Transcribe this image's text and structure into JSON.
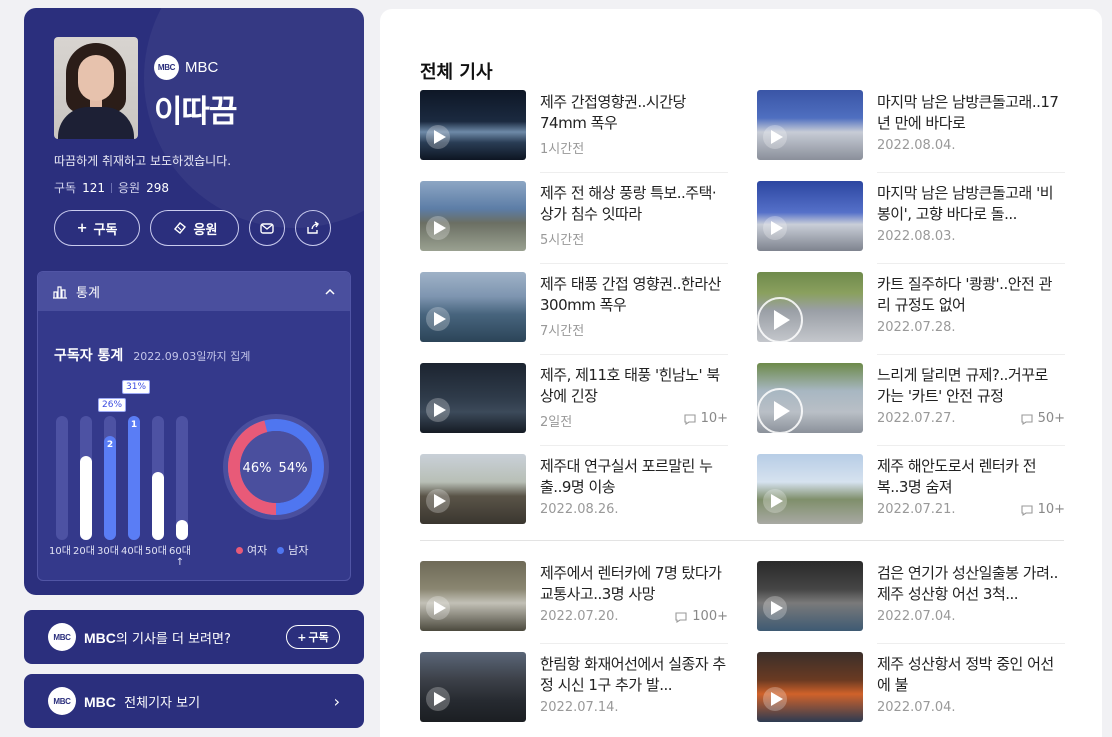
{
  "profile": {
    "brand": "MBC",
    "logo_text": "MBC",
    "name": "이따끔",
    "intro": "따끔하게 취재하고 보도하겠습니다.",
    "subscribe_label": "구독",
    "subscribe_count": "121",
    "cheer_label": "응원",
    "cheer_count": "298",
    "subscribe_button": "구독",
    "cheer_button": "응원"
  },
  "stats": {
    "header": "통계",
    "title": "구독자 통계",
    "date_note": "2022.09.03일까지 집계",
    "tag_30s": "26%",
    "tag_40s": "31%",
    "rank_30s": "2",
    "rank_40s": "1",
    "female_pct": "46%",
    "male_pct": "54%",
    "legend_female": "여자",
    "legend_male": "남자",
    "colors": {
      "female": "#e85a78",
      "male": "#4f76f0"
    }
  },
  "chart_data": {
    "type": "bar",
    "categories": [
      "10대",
      "20대",
      "30대",
      "40대",
      "50대",
      "60대↑"
    ],
    "values": [
      0,
      21,
      26,
      31,
      17,
      5
    ],
    "highlight": [
      false,
      false,
      true,
      true,
      false,
      false
    ],
    "pie": {
      "type": "pie",
      "labels": [
        "여자",
        "남자"
      ],
      "values": [
        46,
        54
      ]
    }
  },
  "promo": {
    "more_brand": "MBC",
    "more_text": "의 기사를 더 보려면?",
    "more_button": "구독",
    "all_brand": "MBC",
    "all_text": "전체기자 보기"
  },
  "main": {
    "title": "전체 기사",
    "articles": [
      {
        "title": "제주 간접영향권..시간당 74mm 폭우",
        "date": "1시간전",
        "comments": "",
        "thumb": "waves"
      },
      {
        "title": "마지막 남은 남방큰돌고래..17년 만에 바다로",
        "date": "2022.08.04.",
        "comments": "",
        "thumb": "dolphin"
      },
      {
        "title": "제주 전 해상 풍랑 특보..주택·상가 침수 잇따라",
        "date": "5시간전",
        "comments": "",
        "thumb": "coast"
      },
      {
        "title": "마지막 남은 남방큰돌고래 '비봉이', 고향 바다로 돌...",
        "date": "2022.08.03.",
        "comments": "",
        "thumb": "dolphin2"
      },
      {
        "title": "제주 태풍 간접 영향권..한라산 300mm 폭우",
        "date": "7시간전",
        "comments": "",
        "thumb": "harbor"
      },
      {
        "title": "카트 질주하다 '쾅쾅'..안전 관리 규정도 없어",
        "date": "2022.07.28.",
        "comments": "",
        "thumb": "kart"
      },
      {
        "title": "제주, 제11호 태풍 '힌남노' 북상에 긴장",
        "date": "2일전",
        "comments": "10+",
        "thumb": "storm"
      },
      {
        "title": "느리게 달리면 규제?..거꾸로 가는 '카트' 안전 규정",
        "date": "2022.07.27.",
        "comments": "50+",
        "thumb": "kart2"
      },
      {
        "title": "제주대 연구실서 포르말린 누출..9명 이송",
        "date": "2022.08.26.",
        "comments": "",
        "thumb": "statue"
      },
      {
        "title": "제주 해안도로서 렌터카 전복..3명 숨져",
        "date": "2022.07.21.",
        "comments": "10+",
        "thumb": "road"
      },
      {
        "title": "제주에서 렌터카에 7명 탔다가 교통사고..3명 사망",
        "date": "2022.07.20.",
        "comments": "100+",
        "thumb": "crash"
      },
      {
        "title": "검은 연기가 성산일출봉 가려..제주 성산항 어선 3척...",
        "date": "2022.07.04.",
        "comments": "",
        "thumb": "fire"
      },
      {
        "title": "한림항 화재어선에서 실종자 추정 시신 1구 추가 발...",
        "date": "2022.07.14.",
        "comments": "",
        "thumb": "rescue"
      },
      {
        "title": "제주 성산항서 정박 중인 어선에 불",
        "date": "2022.07.04.",
        "comments": "",
        "thumb": "fire2"
      }
    ]
  }
}
